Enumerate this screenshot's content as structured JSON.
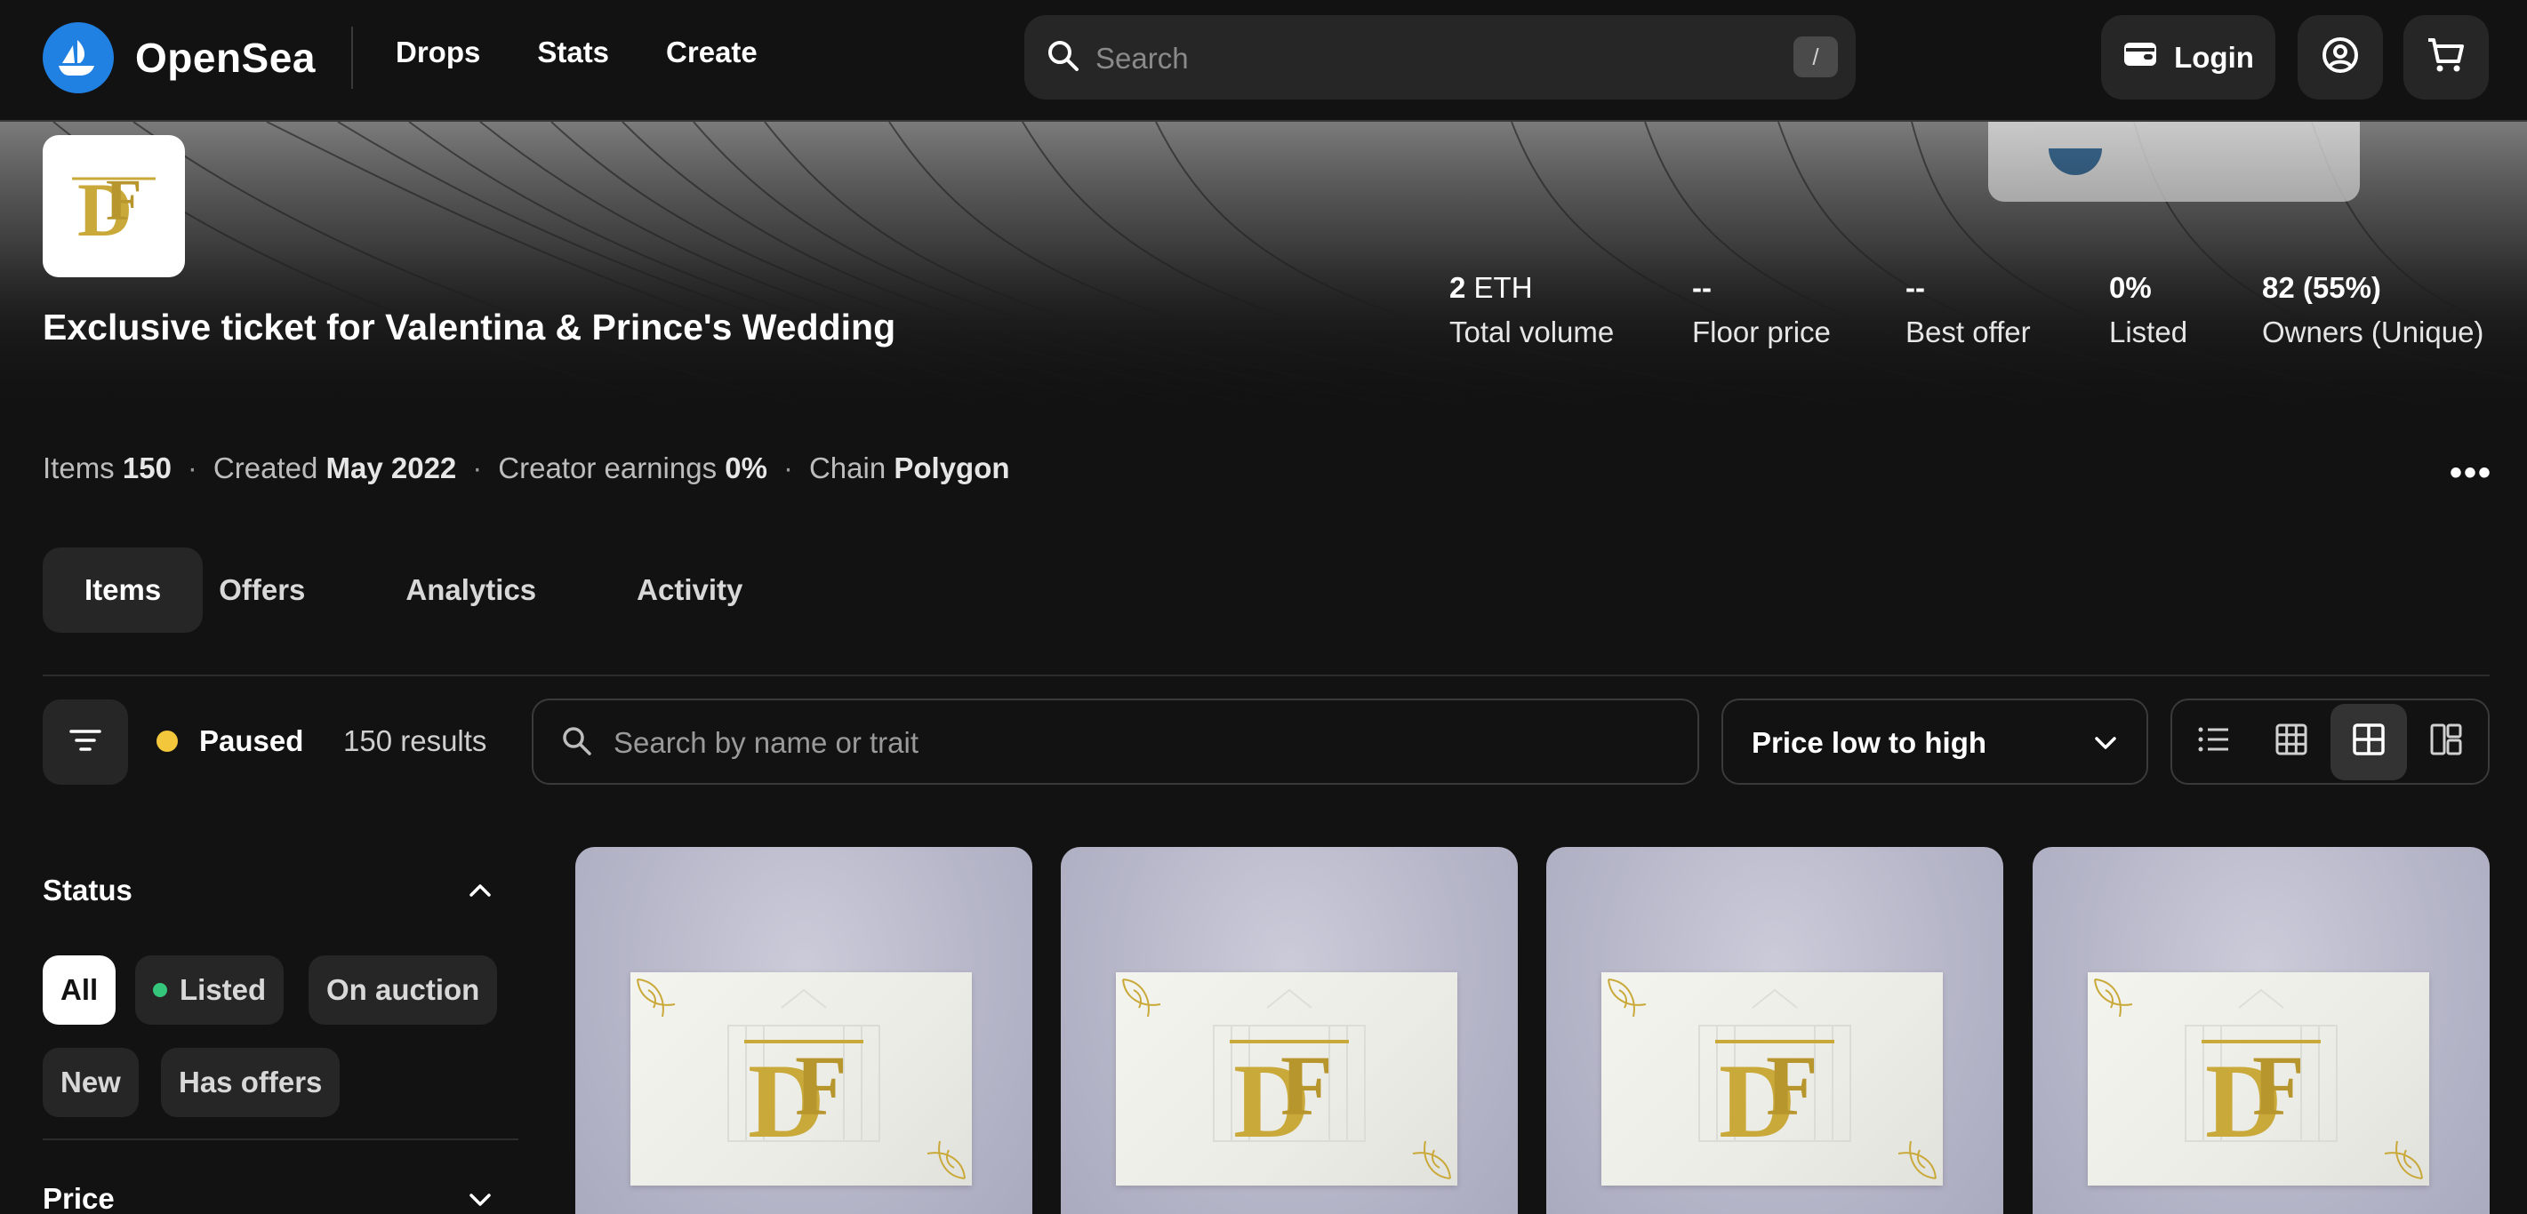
{
  "nav": {
    "brand": "OpenSea",
    "links": [
      "Drops",
      "Stats",
      "Create"
    ],
    "search_placeholder": "Search",
    "search_shortcut": "/",
    "login_label": "Login"
  },
  "collection": {
    "logo_monogram": "DF",
    "title": "Exclusive ticket for Valentina & Prince's Wedding",
    "stats": [
      {
        "value": "2",
        "unit": " ETH",
        "label": "Total volume"
      },
      {
        "value": "--",
        "unit": "",
        "label": "Floor price"
      },
      {
        "value": "--",
        "unit": "",
        "label": "Best offer"
      },
      {
        "value": "0%",
        "unit": "",
        "label": "Listed"
      },
      {
        "value": "82 (55%)",
        "unit": "",
        "label": "Owners (Unique)"
      }
    ],
    "meta": {
      "items_label": "Items",
      "items_value": "150",
      "created_label": "Created",
      "created_value": "May 2022",
      "earnings_label": "Creator earnings",
      "earnings_value": "0%",
      "chain_label": "Chain",
      "chain_value": "Polygon",
      "separator": "·"
    },
    "more_label": "•••"
  },
  "tabs": [
    "Items",
    "Offers",
    "Analytics",
    "Activity"
  ],
  "active_tab": "Items",
  "toolbar": {
    "status_label": "Paused",
    "results_label": "150 results",
    "item_search_placeholder": "Search by name or trait",
    "sort_label": "Price low to high",
    "status_color": "#f2c73b"
  },
  "sidebar": {
    "status_title": "Status",
    "status_chips": [
      "All",
      "Listed",
      "On auction",
      "New",
      "Has offers"
    ],
    "price_title": "Price"
  },
  "grid": {
    "item_count_visible": 4,
    "ticket_monogram": "DF"
  },
  "colors": {
    "background": "#121212",
    "surface": "#262626",
    "brand_blue": "#2081e2",
    "gold": "#c9a93a",
    "listed_green": "#34c77b"
  },
  "icons": [
    "opensea-boat-icon",
    "search-icon",
    "wallet-icon",
    "account-icon",
    "cart-icon",
    "filter-icon",
    "list-view-icon",
    "grid-small-icon",
    "grid-large-icon",
    "masonry-icon",
    "chevron-down-icon",
    "chevron-up-icon"
  ]
}
